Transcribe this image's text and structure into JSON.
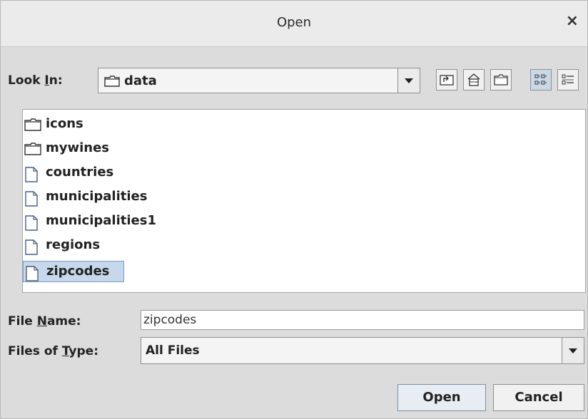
{
  "window": {
    "title": "Open",
    "close_glyph": "×"
  },
  "look_in": {
    "label_pre": "Look ",
    "label_mnemonic": "I",
    "label_post": "n:",
    "selected": "data",
    "icon": "folder-icon"
  },
  "toolbar": [
    {
      "name": "up-one-level",
      "icon": "up-folder-icon"
    },
    {
      "name": "home",
      "icon": "home-icon"
    },
    {
      "name": "new-folder",
      "icon": "new-folder-icon"
    },
    {
      "name": "list-view",
      "icon": "list-view-icon",
      "active": true
    },
    {
      "name": "details-view",
      "icon": "details-view-icon"
    }
  ],
  "files": [
    {
      "name": "icons",
      "type": "folder"
    },
    {
      "name": "mywines",
      "type": "folder"
    },
    {
      "name": "countries",
      "type": "file"
    },
    {
      "name": "municipalities",
      "type": "file"
    },
    {
      "name": "municipalities1",
      "type": "file"
    },
    {
      "name": "regions",
      "type": "file"
    },
    {
      "name": "zipcodes",
      "type": "file",
      "selected": true
    }
  ],
  "file_name": {
    "label_pre": "File ",
    "label_mnemonic": "N",
    "label_post": "ame:",
    "value": "zipcodes"
  },
  "file_type": {
    "label_pre": "Files of ",
    "label_mnemonic": "T",
    "label_post": "ype:",
    "selected": "All Files"
  },
  "buttons": {
    "open": "Open",
    "cancel": "Cancel"
  },
  "colors": {
    "selection_bg": "#c8d8ec",
    "selection_border": "#7a9cc6"
  }
}
